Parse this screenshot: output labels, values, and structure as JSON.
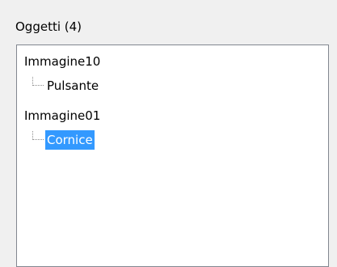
{
  "panel": {
    "label": "Oggetti (4)"
  },
  "tree": {
    "nodes": [
      {
        "label": "Immagine10",
        "level": 0,
        "selected": false
      },
      {
        "label": "Pulsante",
        "level": 1,
        "selected": false
      },
      {
        "label": "Immagine01",
        "level": 0,
        "selected": false
      },
      {
        "label": "Cornice",
        "level": 1,
        "selected": true
      }
    ]
  },
  "colors": {
    "selection_background": "#3399ff",
    "selection_text": "#ffffff",
    "panel_background": "#f0f0f0",
    "tree_border": "#828790"
  }
}
